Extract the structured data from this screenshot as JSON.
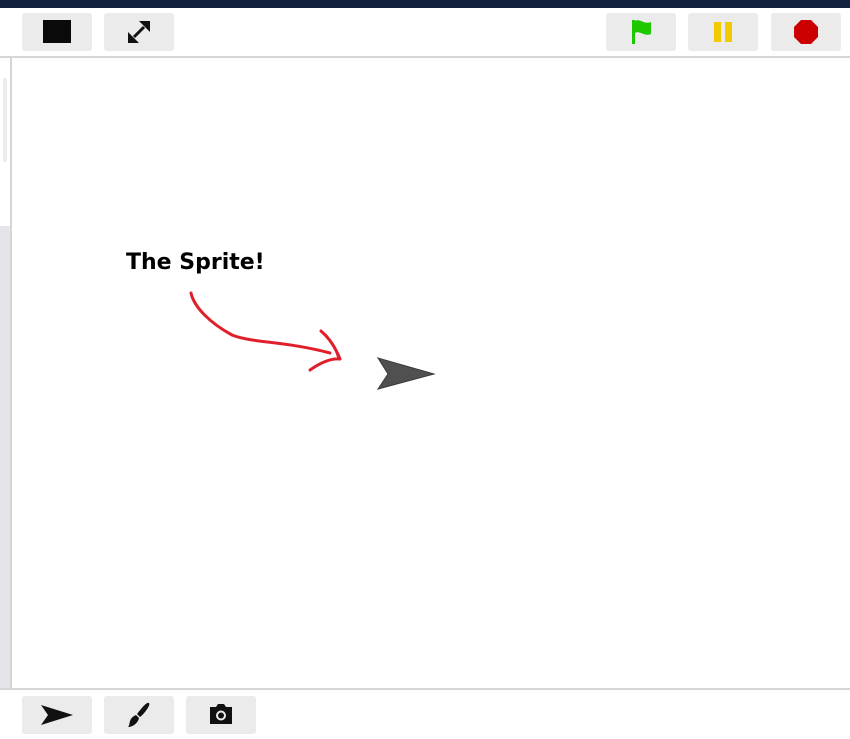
{
  "top_toolbar": {
    "left_buttons": [
      {
        "name": "stage-toggle-button",
        "icon": "black-square-icon"
      },
      {
        "name": "fullscreen-button",
        "icon": "expand-arrows-icon"
      }
    ],
    "right_buttons": [
      {
        "name": "green-flag-button",
        "icon": "green-flag-icon",
        "color": "#1ec700"
      },
      {
        "name": "pause-button",
        "icon": "pause-icon",
        "color": "#f3c900"
      },
      {
        "name": "stop-button",
        "icon": "stop-octagon-icon",
        "color": "#cc0000"
      }
    ]
  },
  "stage": {
    "annotation_text": "The Sprite!",
    "annotation_arrow_color": "#e01f2a",
    "sprite_icon": "arrow-sprite-icon",
    "sprite_color": "#505050"
  },
  "bottom_toolbar": {
    "buttons": [
      {
        "name": "turtle-sprite-button",
        "icon": "turtle-arrow-icon"
      },
      {
        "name": "paint-brush-button",
        "icon": "paint-brush-icon"
      },
      {
        "name": "camera-button",
        "icon": "camera-icon"
      }
    ]
  },
  "colors": {
    "top_strip": "#14213d",
    "button_bg": "#ebebeb",
    "divider": "#d6d6d6"
  }
}
